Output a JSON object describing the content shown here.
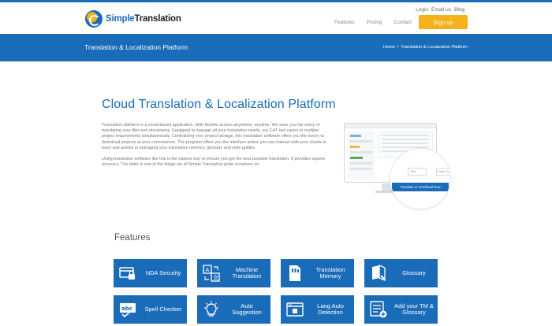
{
  "brand": {
    "part1": "Simple",
    "part2": "Translation"
  },
  "top_links": [
    "Login",
    "Email us",
    "Blog"
  ],
  "nav": {
    "items": [
      "Features",
      "Pricing",
      "Contact"
    ],
    "signup": "Sign up"
  },
  "banner": {
    "title": "Translation & Localization Platform",
    "breadcrumb": {
      "home": "Home",
      "sep": "/",
      "current": "Translation & Localization Platform"
    }
  },
  "content": {
    "heading": "Cloud Translation & Localization Platform",
    "para1": "Translation platform is a cloud-based application. With flexible access anywhere, anytime. We save you the worry of translating your files and documents. Equipped to manage all your translation needs, our CAT tool caters to multiple project requirements simultaneously. Centralizing your project storage, this translation software offers you the luxury to download projects at your convenience. The program offers you the interface where you can interact with your clients or team and assists in managing your translation memory, glossary and style guides.",
    "para2": "Using translation software like this is the easiest way to ensure you get the best possible translation. It provides superb accuracy. The latter is one of the things we at Simple Translation pride ourselves on."
  },
  "illustration": {
    "field1": "Title",
    "field2": "Style Gu",
    "cta": "Translate or Proofread Now"
  },
  "features": {
    "title": "Features",
    "tiles": [
      {
        "label": "NDA Security",
        "icon": "lock-card-icon"
      },
      {
        "label": "Machine Translation",
        "icon": "translate-icon"
      },
      {
        "label": "Translation Memory",
        "icon": "memory-card-icon"
      },
      {
        "label": "Glossary",
        "icon": "book-icon"
      },
      {
        "label": "Spell Checker",
        "icon": "abc-check-icon"
      },
      {
        "label": "Auto Suggestion",
        "icon": "lightbulb-icon"
      },
      {
        "label": "Lang Auto Detection",
        "icon": "browser-window-icon"
      },
      {
        "label": "Add your TM & Glossary",
        "icon": "list-add-icon"
      }
    ]
  },
  "colors": {
    "primary": "#1a6bb8",
    "accent": "#f6b21b"
  }
}
